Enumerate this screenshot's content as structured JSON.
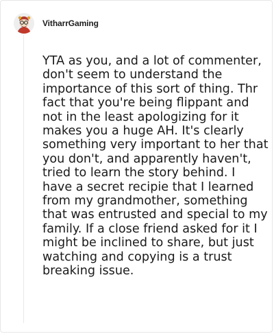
{
  "comment": {
    "username": "VitharrGaming",
    "avatar_icon": "cartoon-character-avatar-icon",
    "body": "YTA as you, and a lot of commenter, don't seem to understand the importance of this sort of thing. Thr fact that you're being flippant and not in the least apologizing for it makes you a huge AH. It's clearly something very important to her that you don't, and apparently haven't, tried to learn the story behind. I have a secret recipie that I learned from my grandmother, something that was entrusted and special to my family. If a close friend asked for it I might be inclined to share, but just watching and copying is a trust breaking issue."
  },
  "colors": {
    "text": "#1a1a1a",
    "username": "#1c1c1c",
    "border": "#e6e6e6",
    "thread_line": "#e8e8e8"
  }
}
